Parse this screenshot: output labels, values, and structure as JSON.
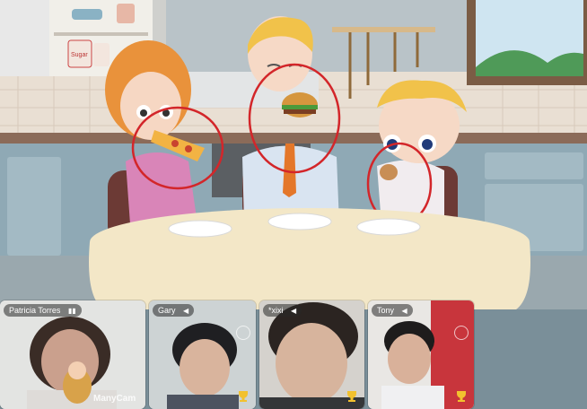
{
  "participants": [
    {
      "name": "Patricia Torres",
      "signal": "▮▮",
      "watermark": "ManyCam"
    },
    {
      "name": "Gary",
      "signal": "◀"
    },
    {
      "name": "*xixi",
      "signal": "◀"
    },
    {
      "name": "Tony",
      "signal": "◀"
    }
  ],
  "kitchen": {
    "canister_label": "Sugar"
  },
  "colors": {
    "wall": "#b9c3c8",
    "tile_wall": "#e9dfd3",
    "cabinet": "#8fa9b5",
    "table": "#f3e7c7",
    "annotation": "#d3262a",
    "tile_bg": "#cfd5d8"
  }
}
